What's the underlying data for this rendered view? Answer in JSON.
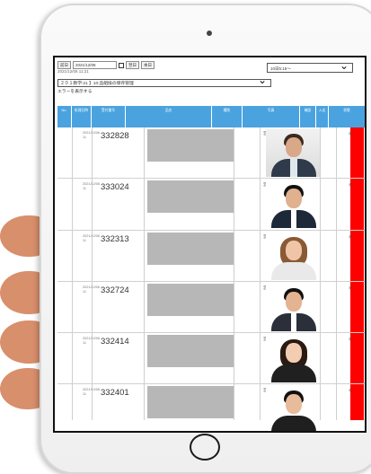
{
  "toolbar": {
    "prev_label": "前日",
    "date_value": "2021/12/06",
    "next_label": "翌日",
    "today_label": "本日"
  },
  "time_text": "2021/12/06 11:21",
  "right_select": {
    "value": "10日5:15〜"
  },
  "main_select": {
    "value": "２０１教学:21 】10:品組換の保存管理"
  },
  "error_link": "エラーを表示する",
  "headers": [
    "No.",
    "処理日時",
    "受付番号",
    "品名",
    "種別",
    "写真",
    "確認",
    "入出",
    "状態"
  ],
  "rows": [
    {
      "date": "2021/12/06 11",
      "id": "332828",
      "dept": "営通AT",
      "flag": "未"
    },
    {
      "date": "2021/12/06 11",
      "id": "333024",
      "dept": "営通AT",
      "flag": "未"
    },
    {
      "date": "2021/12/06 11",
      "id": "332313",
      "dept": "営通AT",
      "flag": "未"
    },
    {
      "date": "2021/12/06 11",
      "id": "332724",
      "dept": "営通AT",
      "flag": "未"
    },
    {
      "date": "2021/12/06 11",
      "id": "332414",
      "dept": "営通AT",
      "flag": "未"
    },
    {
      "date": "2021/12/06 11",
      "id": "332401",
      "dept": "営通AT",
      "flag": "未"
    }
  ],
  "colors": {
    "header_blue": "#4aa3df",
    "status_red": "#ff0000",
    "redacted_gray": "#b7b7b7"
  }
}
